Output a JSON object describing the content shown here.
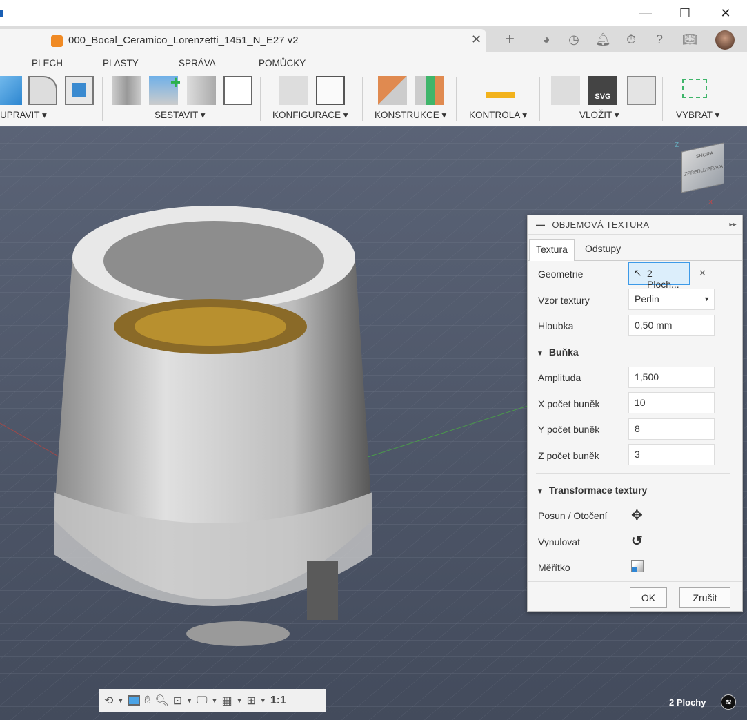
{
  "window": {
    "minimize": "—",
    "maximize": "☐",
    "close": "✕"
  },
  "document": {
    "title": "000_Bocal_Ceramico_Lorenzetti_1451_N_E27 v2",
    "close": "✕",
    "new_tab": "+"
  },
  "toolbar": {
    "tabs": [
      "PLECH",
      "PLASTY",
      "SPRÁVA",
      "POMŮCKY"
    ],
    "groups": [
      "UPRAVIT ▾",
      "SESTAVIT ▾",
      "KONFIGURACE ▾",
      "KONSTRUKCE ▾",
      "KONTROLA ▾",
      "VLOŽIT ▾",
      "VYBRAT ▾"
    ],
    "svg_label": "SVG"
  },
  "dialog": {
    "title": "OBJEMOVÁ TEXTURA",
    "tabs": [
      "Textura",
      "Odstupy"
    ],
    "geometry_label": "Geometrie",
    "geometry_value": "2 Ploch...",
    "clear": "✕",
    "pattern_label": "Vzor textury",
    "pattern_value": "Perlin",
    "depth_label": "Hloubka",
    "depth_value": "0,50 mm",
    "cell_section": "Buňka",
    "amplitude_label": "Amplituda",
    "amplitude_value": "1,500",
    "x_label": "X počet buněk",
    "x_value": "10",
    "y_label": "Y počet buněk",
    "y_value": "8",
    "z_label": "Z počet buněk",
    "z_value": "3",
    "transform_section": "Transformace textury",
    "move_label": "Posun / Otočení",
    "reset_label": "Vynulovat",
    "scale_label": "Měřítko",
    "ok": "OK",
    "cancel": "Zrušit"
  },
  "viewcube": {
    "front": "ZPŘEDU",
    "right": "ZPRAVA",
    "top": "SHORA",
    "z": "Z",
    "x": "X"
  },
  "nav": {
    "ratio": "1:1"
  },
  "status": {
    "selection": "2 Plochy"
  }
}
